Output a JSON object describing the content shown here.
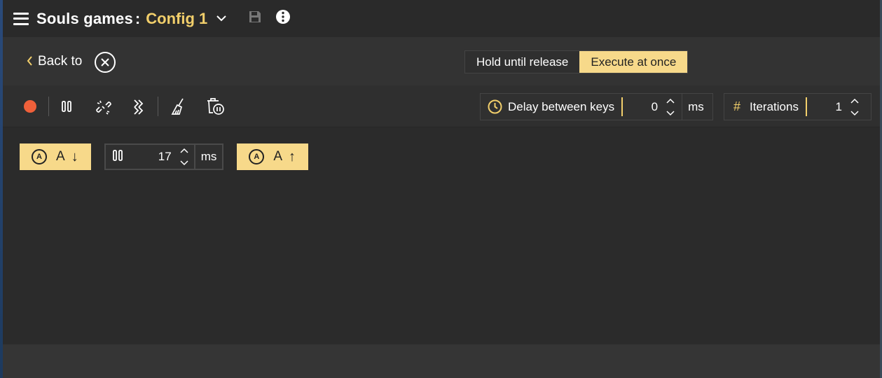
{
  "titlebar": {
    "title": "Souls games",
    "colon": ":",
    "config_name": "Config 1",
    "icons": [
      "menu-icon",
      "chevron-down-icon",
      "save-icon",
      "info-icon"
    ]
  },
  "nav": {
    "back_label": "Back to",
    "back_icon": "chevron-left-icon",
    "close_icon": "close-circle-icon"
  },
  "mode": {
    "hold_label": "Hold until release",
    "execute_label": "Execute at once",
    "selected": "Execute at once"
  },
  "toolbar": {
    "icons": [
      "record-icon",
      "pause-icon",
      "unlink-icon",
      "chain-icon",
      "brush-icon",
      "delete-pause-icon"
    ],
    "delay": {
      "label": "Delay between keys",
      "value": "0",
      "unit": "ms"
    },
    "iterations": {
      "symbol": "#",
      "label": "Iterations",
      "value": "1"
    }
  },
  "sequence": [
    {
      "type": "key",
      "circle_letter": "A",
      "key": "A",
      "direction": "down",
      "arrow": "↓"
    },
    {
      "type": "delay",
      "value": "17",
      "unit": "ms"
    },
    {
      "type": "key",
      "circle_letter": "A",
      "key": "A",
      "direction": "up",
      "arrow": "↑"
    }
  ],
  "colors": {
    "accent": "#f2cf6b",
    "chip_bg": "#f7d98a",
    "record": "#f0603a",
    "background": "#2b2b2b"
  }
}
